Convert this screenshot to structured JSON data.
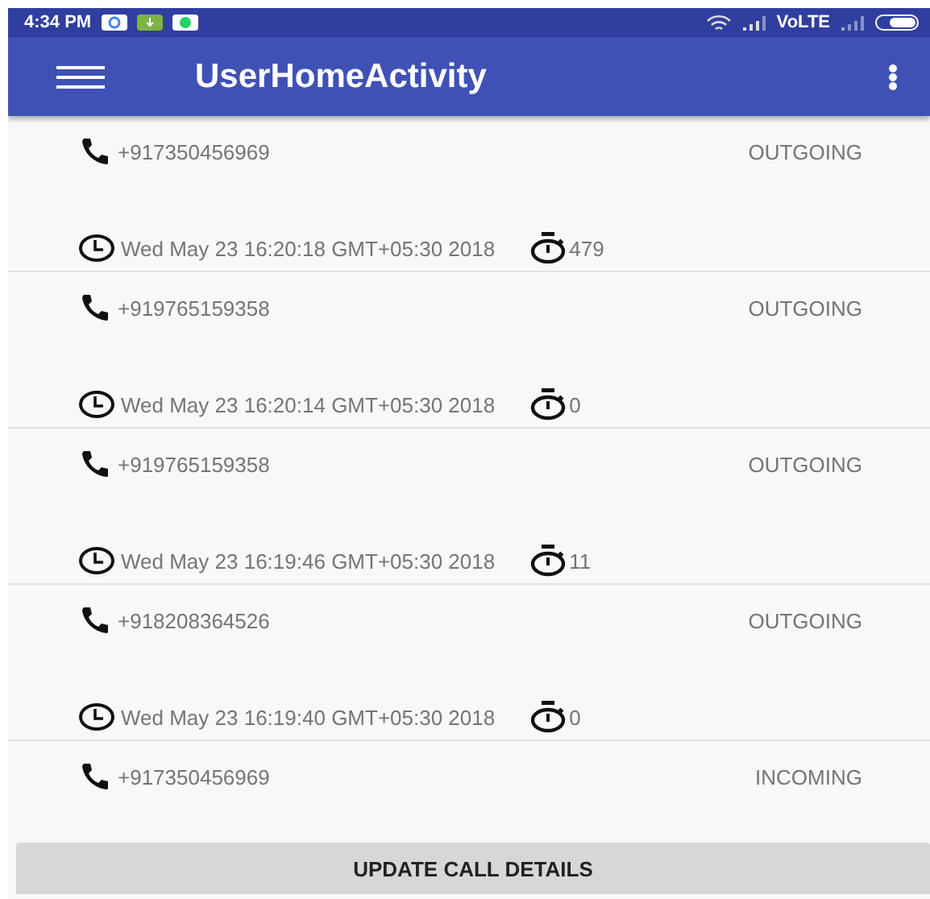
{
  "status_bar": {
    "time": "4:34 PM",
    "network": "VoLTE"
  },
  "app_bar": {
    "title": "UserHomeActivity"
  },
  "calls": [
    {
      "number": "+917350456969",
      "direction": "OUTGOING",
      "date": "Wed May 23 16:20:18 GMT+05:30 2018",
      "duration": "479"
    },
    {
      "number": "+919765159358",
      "direction": "OUTGOING",
      "date": "Wed May 23 16:20:14 GMT+05:30 2018",
      "duration": "0"
    },
    {
      "number": "+919765159358",
      "direction": "OUTGOING",
      "date": "Wed May 23 16:19:46 GMT+05:30 2018",
      "duration": "11"
    },
    {
      "number": "+918208364526",
      "direction": "OUTGOING",
      "date": "Wed May 23 16:19:40 GMT+05:30 2018",
      "duration": "0"
    },
    {
      "number": "+917350456969",
      "direction": "INCOMING"
    }
  ],
  "button": {
    "label": "UPDATE CALL DETAILS"
  }
}
